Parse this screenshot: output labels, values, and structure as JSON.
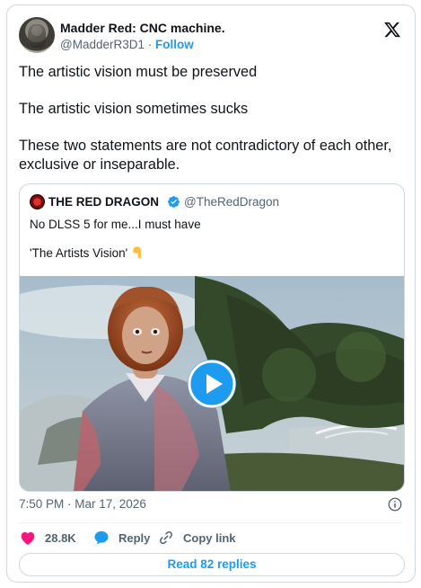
{
  "author": {
    "name": "Madder Red: CNC machine.",
    "handle": "@MadderR3D1",
    "separator": " · ",
    "follow_label": "Follow"
  },
  "tweet": {
    "paragraphs": [
      "The artistic vision must be preserved",
      "The artistic vision sometimes sucks",
      "These two statements are not contradictory of each other, exclusive or inseparable."
    ]
  },
  "quote": {
    "name": "THE RED DRAGON",
    "handle": "@TheRedDragon",
    "line1": "No DLSS 5 for me...I must have",
    "line2": "'The Artists Vision'",
    "emoji": "point-down-emoji"
  },
  "meta": {
    "time": "7:50 PM",
    "separator": " · ",
    "date": "Mar 17, 2026"
  },
  "actions": {
    "likes": "28.8K",
    "reply_label": "Reply",
    "copy_label": "Copy link"
  },
  "read_replies_label": "Read 82 replies",
  "colors": {
    "accent": "#1d9bf0",
    "like": "#f91880",
    "text": "#0f1419",
    "muted": "#536471",
    "border": "#cfd9de"
  }
}
